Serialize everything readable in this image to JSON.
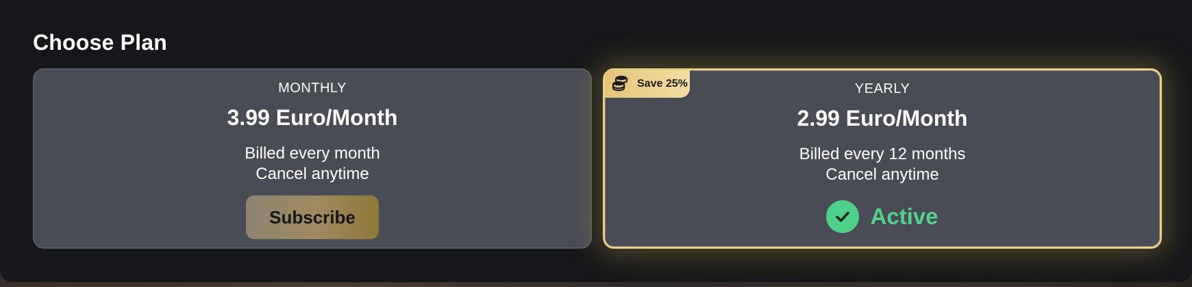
{
  "header": {
    "title": "Choose Plan"
  },
  "plans": [
    {
      "label": "MONTHLY",
      "price": "3.99 Euro/Month",
      "billing": "Billed every month",
      "cancel": "Cancel anytime",
      "action_label": "Subscribe"
    },
    {
      "label": "YEARLY",
      "price": "2.99 Euro/Month",
      "billing": "Billed every 12 months",
      "cancel": "Cancel anytime",
      "badge": "Save 25%",
      "badge_icon": "coins-icon",
      "status_label": "Active",
      "status_icon": "check-circle-icon"
    }
  ],
  "colors": {
    "panel_bg": "#15171a",
    "card_bg": "#494c54",
    "gold_accent": "#e8cf86",
    "active_green": "#53d28d"
  }
}
